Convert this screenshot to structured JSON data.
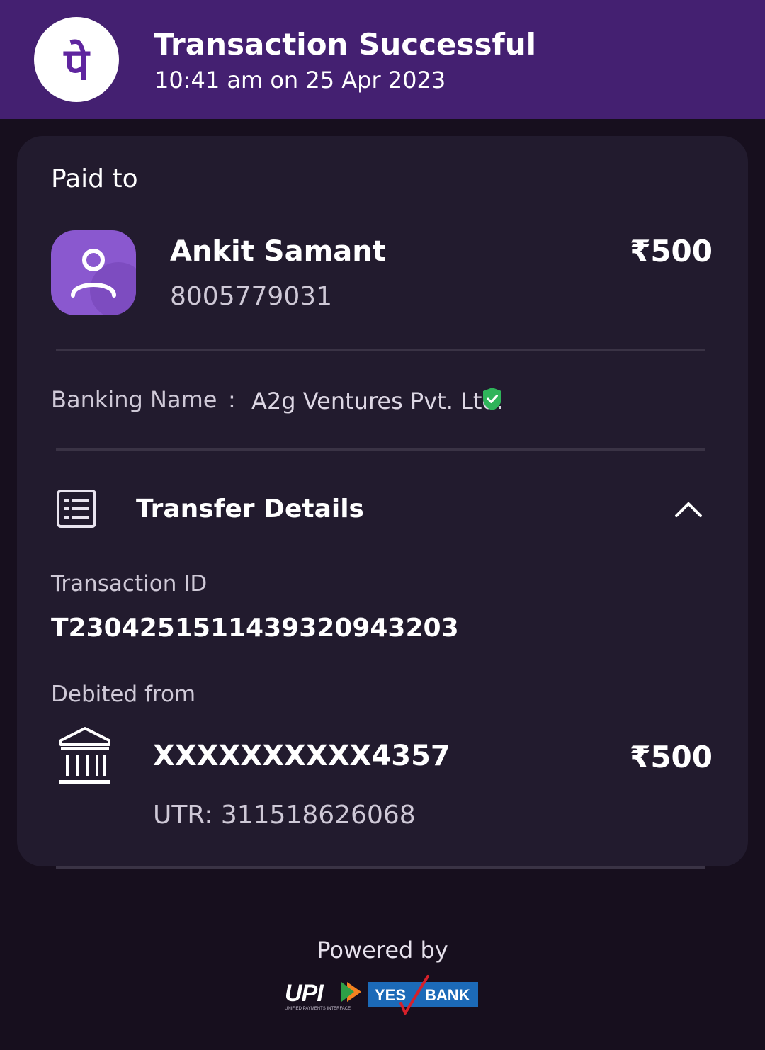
{
  "header": {
    "logo_icon": "phonepe-logo-icon",
    "logo_glyph": "पे",
    "title": "Transaction Successful",
    "timestamp": "10:41 am on 25 Apr 2023",
    "background_color": "#442071"
  },
  "payee": {
    "section_label": "Paid to",
    "avatar_icon": "user-icon",
    "name": "Ankit Samant",
    "phone": "8005779031",
    "amount": "₹500"
  },
  "banking_name": {
    "label": "Banking Name",
    "separator": ":",
    "value": "A2g Ventures Pvt. Ltd.",
    "verified_icon": "verified-shield-icon",
    "verified_color": "#2fb45a"
  },
  "transfer_details": {
    "icon": "receipt-list-icon",
    "title": "Transfer Details",
    "toggle_icon": "chevron-up-icon",
    "transaction_id_label": "Transaction ID",
    "transaction_id": "T2304251511439320943203",
    "debited_from_label": "Debited from",
    "bank_icon": "bank-icon",
    "account": "XXXXXXXXXX4357",
    "amount": "₹500",
    "utr": "UTR: 311518626068"
  },
  "footer": {
    "powered_by": "Powered by",
    "upi_logo": "UPI",
    "upi_tagline": "UNIFIED PAYMENTS INTERFACE",
    "bank_logo_left": "YES",
    "bank_logo_right": "BANK"
  }
}
